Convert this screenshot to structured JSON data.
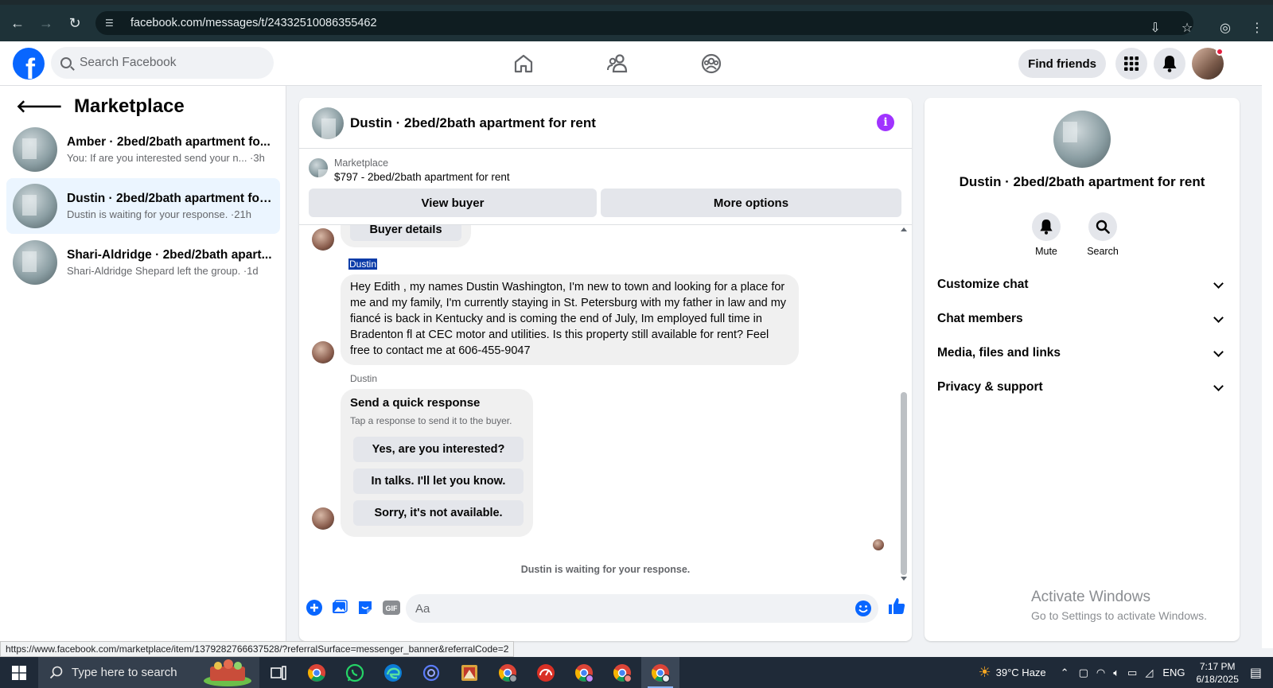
{
  "browser": {
    "url": "facebook.com/messages/t/24332510086355462",
    "status_url": "https://www.facebook.com/marketplace/item/1379282766637528/?referralSurface=messenger_banner&referralCode=2"
  },
  "header": {
    "logo": "f",
    "search_placeholder": "Search Facebook",
    "find_friends": "Find friends"
  },
  "sidebar": {
    "title": "Marketplace",
    "conversations": [
      {
        "name": "Amber · 2bed/2bath apartment fo...",
        "preview": "You: If are you interested send your n... ·3h"
      },
      {
        "name": "Dustin · 2bed/2bath apartment for...",
        "preview": "Dustin is waiting for your response. ·21h"
      },
      {
        "name": "Shari-Aldridge · 2bed/2bath apart...",
        "preview": "Shari-Aldridge Shepard left the group. ·1d"
      }
    ]
  },
  "chat": {
    "title": "Dustin · 2bed/2bath apartment for rent",
    "banner": {
      "label": "Marketplace",
      "price_title": "$797 - 2bed/2bath apartment for rent",
      "view_buyer": "View buyer",
      "more_options": "More options"
    },
    "clipped_bubble": "Buyer details",
    "messages": [
      {
        "sender": "Dustin",
        "text": "Hey Edith  , my names Dustin Washington, I'm new to town and looking for a place for me and my family, I'm currently staying in St. Petersburg with my father in law and my fiancé is back in Kentucky and is coming the end of July, Im employed full time in Bradenton fl at CEC motor and utilities. Is this property still available for rent? Feel free to contact me at 606-455-9047"
      }
    ],
    "quick_response": {
      "sender": "Dustin",
      "title": "Send a quick response",
      "subtitle": "Tap a response to send it to the buyer.",
      "options": [
        "Yes, are you interested?",
        "In talks. I'll let you know.",
        "Sorry, it's not available."
      ]
    },
    "waiting_text": "Dustin is waiting for your response.",
    "composer_placeholder": "Aa",
    "gif_label": "GIF"
  },
  "details": {
    "title": "Dustin · 2bed/2bath apartment for rent",
    "actions": [
      {
        "label": "Mute"
      },
      {
        "label": "Search"
      }
    ],
    "sections": [
      "Customize chat",
      "Chat members",
      "Media, files and links",
      "Privacy & support"
    ]
  },
  "watermark": {
    "line1": "Activate Windows",
    "line2": "Go to Settings to activate Windows."
  },
  "taskbar": {
    "search_placeholder": "Type here to search",
    "weather": "39°C  Haze",
    "language": "ENG",
    "time": "7:17 PM",
    "date": "6/18/2025"
  },
  "colors": {
    "fb_blue": "#0866ff",
    "info_purple": "#a033ff",
    "active_conversation": "#ebf5ff"
  }
}
